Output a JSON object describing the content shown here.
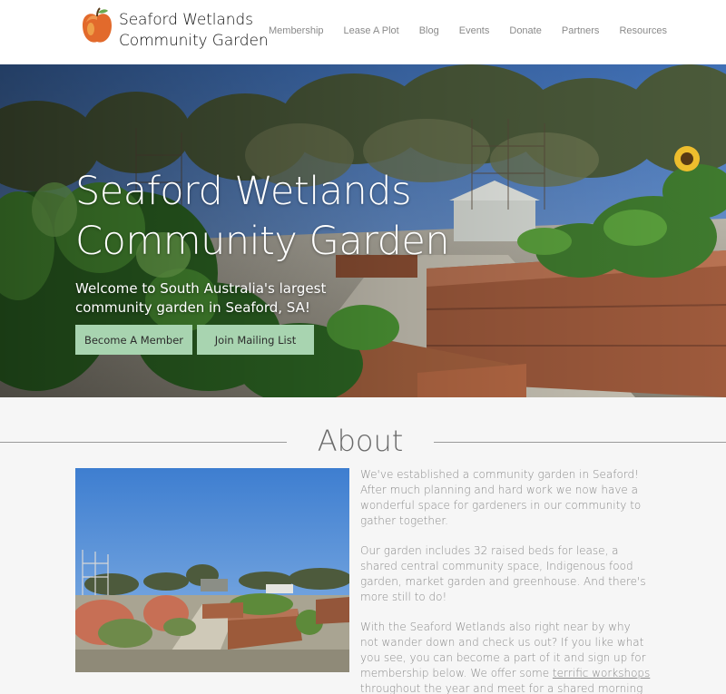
{
  "header": {
    "brand_line1": "Seaford Wetlands",
    "brand_line2": "Community Garden",
    "nav": [
      "Membership",
      "Lease A Plot",
      "Blog",
      "Events",
      "Donate",
      "Partners",
      "Resources"
    ]
  },
  "hero": {
    "title_line1": "Seaford Wetlands",
    "title_line2": "Community Garden",
    "subtitle": "Welcome to South Australia's largest community garden in Seaford, SA!",
    "btn_member": "Become A Member",
    "btn_mailing": "Join Mailing List"
  },
  "about": {
    "heading": "About",
    "p1": "We've established a community garden in Seaford! After much planning and hard work we now have a wonderful space for gardeners in our community to gather together.",
    "p2": "Our garden includes 32 raised beds for lease, a shared central community space, Indigenous food garden, market garden and greenhouse. And there's more still to do!",
    "p3_before": "With the Seaford Wetlands also right near by why not wander down and check us out? If you like what you see, you can become a part of it and sign up for membership below. We offer some ",
    "p3_link": "terrific workshops",
    "p3_after": " throughout the year and meet for a shared morning tea every fortnight."
  },
  "colors": {
    "button": "#a8d4b0",
    "sky": "#5b86c4",
    "timber": "#9e5a3c"
  }
}
